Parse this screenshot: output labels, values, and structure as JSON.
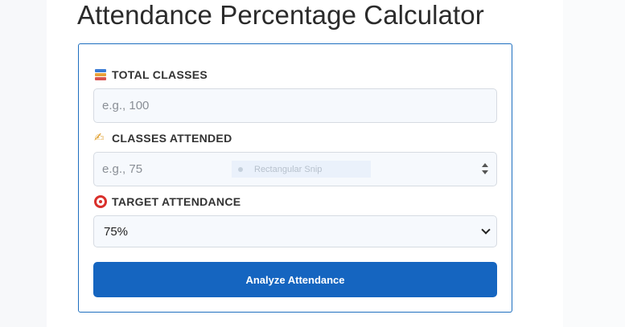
{
  "page": {
    "title": "Attendance Percentage Calculator"
  },
  "form": {
    "total_classes": {
      "label": "TOTAL CLASSES",
      "icon": "books-icon",
      "placeholder": "e.g., 100",
      "value": ""
    },
    "classes_attended": {
      "label": "CLASSES ATTENDED",
      "icon": "writing-hand-icon",
      "placeholder": "e.g., 75",
      "value": ""
    },
    "target_attendance": {
      "label": "TARGET ATTENDANCE",
      "icon": "target-icon",
      "selected": "75%"
    },
    "submit_label": "Analyze Attendance"
  },
  "overlay": {
    "snip_label": "Rectangular Snip"
  },
  "colors": {
    "accent": "#1565c0",
    "card_border": "#1e6fbf",
    "input_bg": "#f6f9fd"
  }
}
